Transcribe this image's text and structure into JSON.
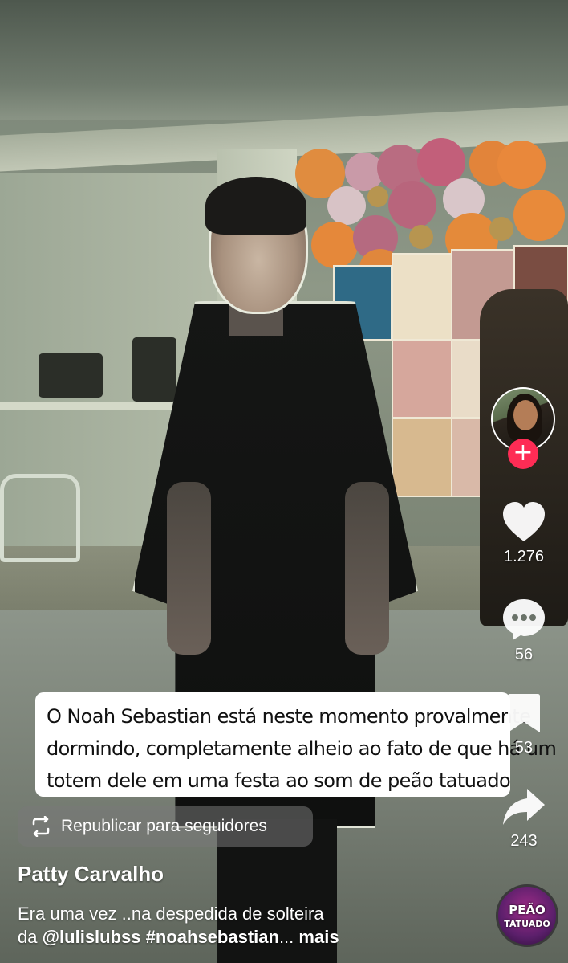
{
  "video_text_overlay": {
    "lines": [
      "O Noah Sebastian está neste momento provalmente",
      "dormindo, completamente alheio ao fato de que há um",
      "totem dele em uma festa ao som de peão tatuado"
    ]
  },
  "sidebar": {
    "likes_count": "1.276",
    "comments_count": "56",
    "bookmarks_count": "53",
    "shares_count": "243"
  },
  "repost": {
    "label": "Republicar para seguidores"
  },
  "post": {
    "author": "Patty Carvalho",
    "caption_line1": "Era uma vez ..na despedida de solteira",
    "caption_prefix": "da ",
    "mention": "@lulislubss",
    "hashtag": "#noahsebastian",
    "ellipsis": "...",
    "more_label": "mais"
  },
  "music_disc": {
    "line1": "PEÃO",
    "line2": "TATUADO"
  },
  "colors": {
    "follow_accent": "#fe2c55",
    "overlay_bg": "#ffffff"
  },
  "icons": [
    "heart-icon",
    "comment-icon",
    "bookmark-icon",
    "share-icon",
    "repost-icon",
    "plus-icon"
  ]
}
